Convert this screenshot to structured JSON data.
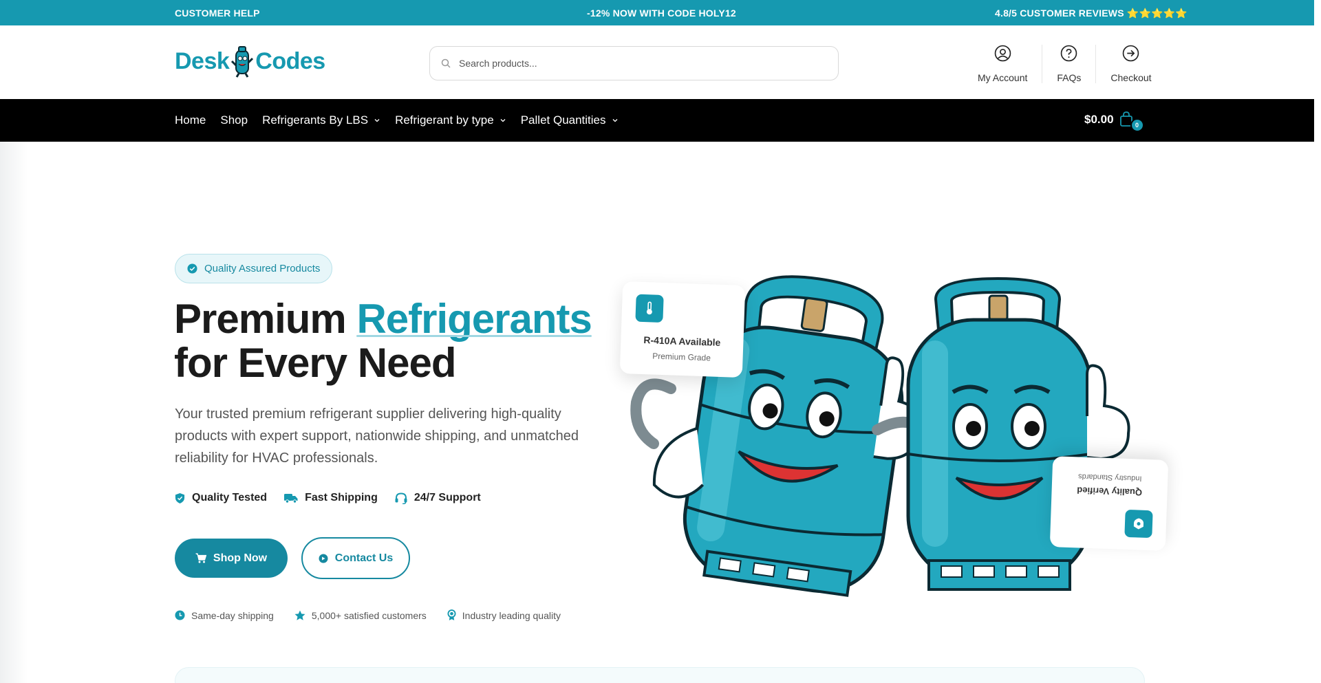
{
  "topbar": {
    "left": "CUSTOMER HELP",
    "center": "-12% NOW WITH CODE HOLY12",
    "right": "4.8/5 CUSTOMER REVIEWS ⭐⭐⭐⭐⭐"
  },
  "header": {
    "logo_part1": "Desk",
    "logo_part2": "Codes",
    "search_placeholder": "Search products...",
    "links": [
      {
        "label": "My Account",
        "icon": "user-icon"
      },
      {
        "label": "FAQs",
        "icon": "question-icon"
      },
      {
        "label": "Checkout",
        "icon": "arrow-right-circle-icon"
      }
    ]
  },
  "nav": {
    "items": [
      {
        "label": "Home",
        "dropdown": false
      },
      {
        "label": "Shop",
        "dropdown": false
      },
      {
        "label": "Refrigerants By LBS",
        "dropdown": true
      },
      {
        "label": "Refrigerant by type",
        "dropdown": true
      },
      {
        "label": "Pallet Quantities",
        "dropdown": true
      }
    ],
    "cart_total": "$0.00",
    "cart_count": "0"
  },
  "hero": {
    "badge": "Quality Assured Products",
    "headline_part1": "Premium ",
    "headline_accent": "Refrigerants",
    "headline_part2": "for Every Need",
    "subtext": "Your trusted premium refrigerant supplier delivering high-quality products with expert support, nationwide shipping, and unmatched reliability for HVAC professionals.",
    "features": [
      "Quality Tested",
      "Fast Shipping",
      "24/7 Support"
    ],
    "primary_button": "Shop Now",
    "secondary_button": "Contact Us",
    "trust": [
      "Same-day shipping",
      "5,000+ satisfied customers",
      "Industry leading quality"
    ]
  },
  "illustration": {
    "card1_title": "R-410A Available",
    "card1_subtitle": "Premium Grade",
    "card2_title": "Quality Verified",
    "card2_subtitle": "Industry Standards"
  },
  "colors": {
    "brand": "#1699b0",
    "brand_dark": "#1689a0",
    "nav_bg": "#000000"
  }
}
